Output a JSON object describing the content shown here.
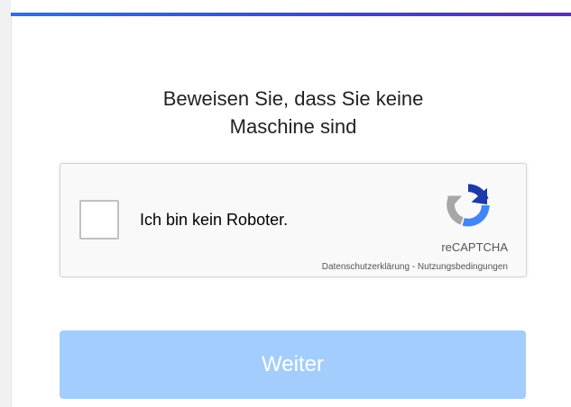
{
  "page": {
    "title_line1": "Beweisen Sie, dass Sie keine",
    "title_line2": "Maschine sind"
  },
  "captcha": {
    "checkbox_label": "Ich bin kein Roboter.",
    "brand": "reCAPTCHA",
    "privacy_link": "Datenschutzerklärung",
    "separator": " - ",
    "terms_link": "Nutzungsbedingungen",
    "checked": false,
    "logo_icon": "recaptcha-logo-icon"
  },
  "actions": {
    "continue_label": "Weiter",
    "continue_disabled": true
  },
  "colors": {
    "accent_bar": "#3f44d6",
    "button_disabled": "#a3cdfd",
    "recaptcha_blue": "#1c3aa9",
    "recaptcha_light_blue": "#4285f4",
    "recaptcha_gray": "#a6a6a6"
  }
}
